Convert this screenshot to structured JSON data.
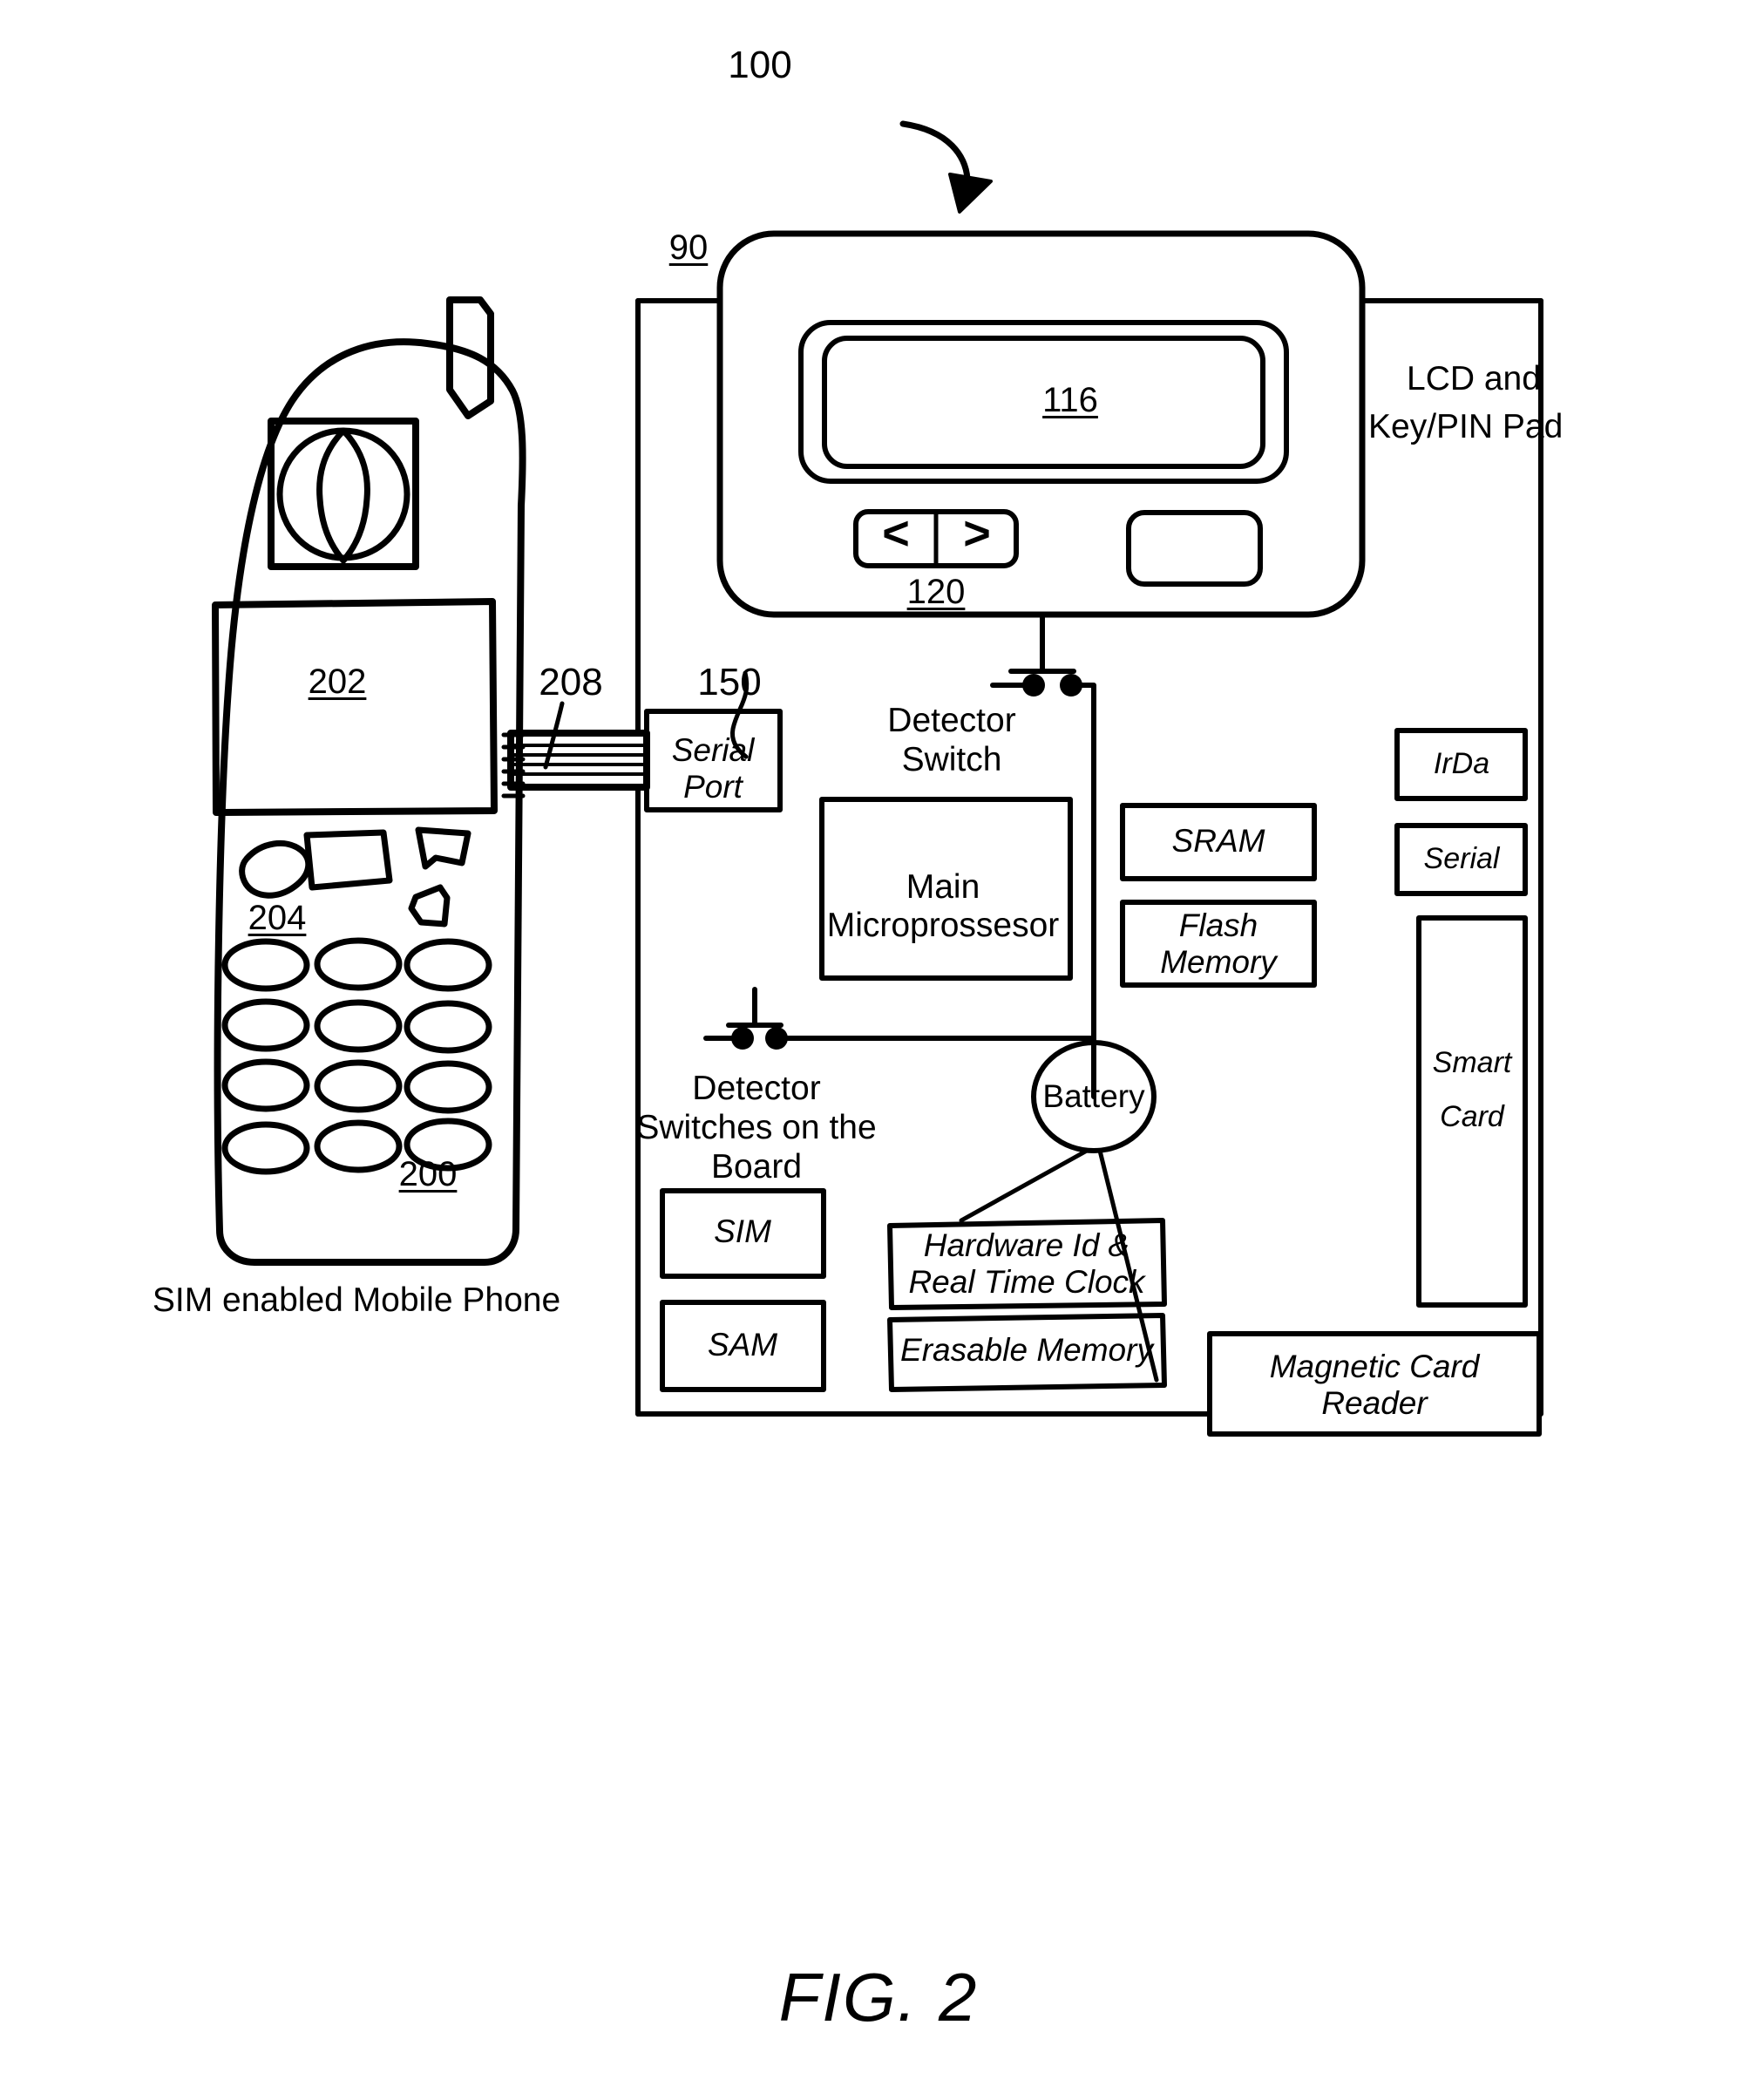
{
  "figure": {
    "caption": "FIG. 2",
    "system_ref": "100"
  },
  "phone": {
    "caption": "SIM enabled Mobile Phone",
    "refs": {
      "device": "200",
      "display": "202",
      "keypad": "204",
      "cable": "208"
    }
  },
  "terminal": {
    "enclosure_ref": "90",
    "lcd_keypad_label": "LCD and\nKey/PIN Pad",
    "lcd_keypad_label_line1": "LCD and",
    "lcd_keypad_label_line2": "Key/PIN Pad",
    "screen_ref": "116",
    "navkeys_ref": "120",
    "navkey_left": "<",
    "navkey_right": ">",
    "serial_port_ref": "150"
  },
  "switches": [
    {
      "name": "detector-switch-top",
      "label": "Detector\nSwitch",
      "line1": "Detector",
      "line2": "Switch"
    },
    {
      "name": "detector-switches-board",
      "label": "Detector\nSwitches on the\nBoard",
      "line1": "Detector",
      "line2": "Switches on the",
      "line3": "Board"
    }
  ],
  "blocks": [
    {
      "id": "serial-port",
      "label": "Serial\nPort",
      "line1": "Serial",
      "line2": "Port"
    },
    {
      "id": "main-microprocessor",
      "label": "Main\nMicroprossesor",
      "line1": "Main",
      "line2": "Microprossesor"
    },
    {
      "id": "sram",
      "label": "SRAM",
      "line1": "SRAM"
    },
    {
      "id": "flash-memory",
      "label": "Flash\nMemory",
      "line1": "Flash",
      "line2": "Memory"
    },
    {
      "id": "sim",
      "label": "SIM",
      "line1": "SIM"
    },
    {
      "id": "sam",
      "label": "SAM",
      "line1": "SAM"
    },
    {
      "id": "hardware-id-rtc",
      "label": "Hardware Id &\nReal Time Clock",
      "line1": "Hardware Id &",
      "line2": "Real Time Clock"
    },
    {
      "id": "erasable-memory",
      "label": "Erasable Memory",
      "line1": "Erasable Memory"
    },
    {
      "id": "battery",
      "label": "Battery",
      "line1": "Battery"
    },
    {
      "id": "irda",
      "label": "IrDa",
      "line1": "IrDa"
    },
    {
      "id": "serial",
      "label": "Serial",
      "line1": "Serial"
    },
    {
      "id": "smart-card",
      "label": "Smart\nCard",
      "line1": "Smart",
      "line2": "Card"
    },
    {
      "id": "magnetic-card-reader",
      "label": "Magnetic Card\nReader",
      "line1": "Magnetic Card",
      "line2": "Reader"
    }
  ],
  "colors": {
    "ink": "#000000",
    "paper": "#ffffff"
  }
}
